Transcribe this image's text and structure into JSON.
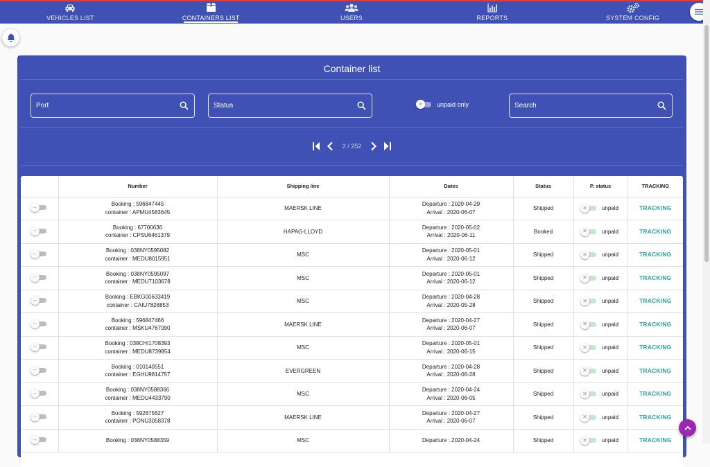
{
  "nav": {
    "items": [
      {
        "label": "VEHICLES LIST",
        "icon": "car-icon"
      },
      {
        "label": "CONTAINERS LIST",
        "icon": "container-icon"
      },
      {
        "label": "USERS",
        "icon": "users-icon"
      },
      {
        "label": "REPORTS",
        "icon": "bar-chart-icon"
      },
      {
        "label": "SYSTEM CONFIG",
        "icon": "gears-icon"
      }
    ],
    "active": "CONTAINERS LIST"
  },
  "page": {
    "title": "Container list",
    "filters": {
      "port_placeholder": "Port",
      "status_placeholder": "Status",
      "unpaid_only_label": "unpaid only",
      "search_placeholder": "Search"
    },
    "pager": {
      "text": "2 / 252"
    }
  },
  "table": {
    "headers": [
      "",
      "Number",
      "Shipping line",
      "Dates",
      "Status",
      "P. status",
      "TRACKING"
    ],
    "rows": [
      {
        "booking": "Booking : 596847445",
        "container": "container : APMU4583645",
        "line": "MAERSK LINE",
        "departure": "Departure : 2020-04-29",
        "arrival": "Arrival : 2020-06-07",
        "status": "Shipped",
        "pstatus": "unpaid",
        "tracking": "TRACKING"
      },
      {
        "booking": "Booking : 67700636",
        "container": "container : CPSU6461379",
        "line": "HAPAG-LLOYD",
        "departure": "Departure : 2020-05-02",
        "arrival": "Arrival : 2020-06-11",
        "status": "Booked",
        "pstatus": "unpaid",
        "tracking": "TRACKING"
      },
      {
        "booking": "Booking : 038NY0595082",
        "container": "container : MEDU8015951",
        "line": "MSC",
        "departure": "Departure : 2020-05-01",
        "arrival": "Arrival : 2020-06-12",
        "status": "Shipped",
        "pstatus": "unpaid",
        "tracking": "TRACKING"
      },
      {
        "booking": "Booking : 038NY0595097",
        "container": "container : MEDU7103678",
        "line": "MSC",
        "departure": "Departure : 2020-05-01",
        "arrival": "Arrival : 2020-06-12",
        "status": "Shipped",
        "pstatus": "unpaid",
        "tracking": "TRACKING"
      },
      {
        "booking": "Booking : EBKG00633419",
        "container": "container : CAIU7828853",
        "line": "MSC",
        "departure": "Departure : 2020-04-28",
        "arrival": "Arrival : 2020-05-28",
        "status": "Shipped",
        "pstatus": "unpaid",
        "tracking": "TRACKING"
      },
      {
        "booking": "Booking : 596847466",
        "container": "container : MSKU4767090",
        "line": "MAERSK LINE",
        "departure": "Departure : 2020-04-27",
        "arrival": "Arrival : 2020-06-07",
        "status": "Shipped",
        "pstatus": "unpaid",
        "tracking": "TRACKING"
      },
      {
        "booking": "Booking : 038CHI1708393",
        "container": "container : MEDU8739854",
        "line": "MSC",
        "departure": "Departure : 2020-05-01",
        "arrival": "Arrival : 2020-06-15",
        "status": "Shipped",
        "pstatus": "unpaid",
        "tracking": "TRACKING"
      },
      {
        "booking": "Booking : 010140551",
        "container": "container : EGHU9814757",
        "line": "EVERGREEN",
        "departure": "Departure : 2020-04-28",
        "arrival": "Arrival : 2020-06-28",
        "status": "Shipped",
        "pstatus": "unpaid",
        "tracking": "TRACKING"
      },
      {
        "booking": "Booking : 038NY0588366",
        "container": "container : MEDU4433790",
        "line": "MSC",
        "departure": "Departure : 2020-04-24",
        "arrival": "Arrival : 2020-06-05",
        "status": "Shipped",
        "pstatus": "unpaid",
        "tracking": "TRACKING"
      },
      {
        "booking": "Booking : 592875627",
        "container": "container : PONU3058378",
        "line": "MAERSK LINE",
        "departure": "Departure : 2020-04-27",
        "arrival": "Arrival : 2020-06-07",
        "status": "Shipped",
        "pstatus": "unpaid",
        "tracking": "TRACKING"
      },
      {
        "booking": "Booking : 038NY0588359",
        "container": "",
        "line": "MSC",
        "departure": "Departure : 2020-04-24",
        "arrival": "",
        "status": "Shipped",
        "pstatus": "unpaid",
        "tracking": "TRACKING"
      }
    ]
  },
  "colors": {
    "primary": "#3f51b5",
    "accent_tracking": "#26a69a",
    "fab": "#9c27b0",
    "top_border": "#e53935"
  }
}
